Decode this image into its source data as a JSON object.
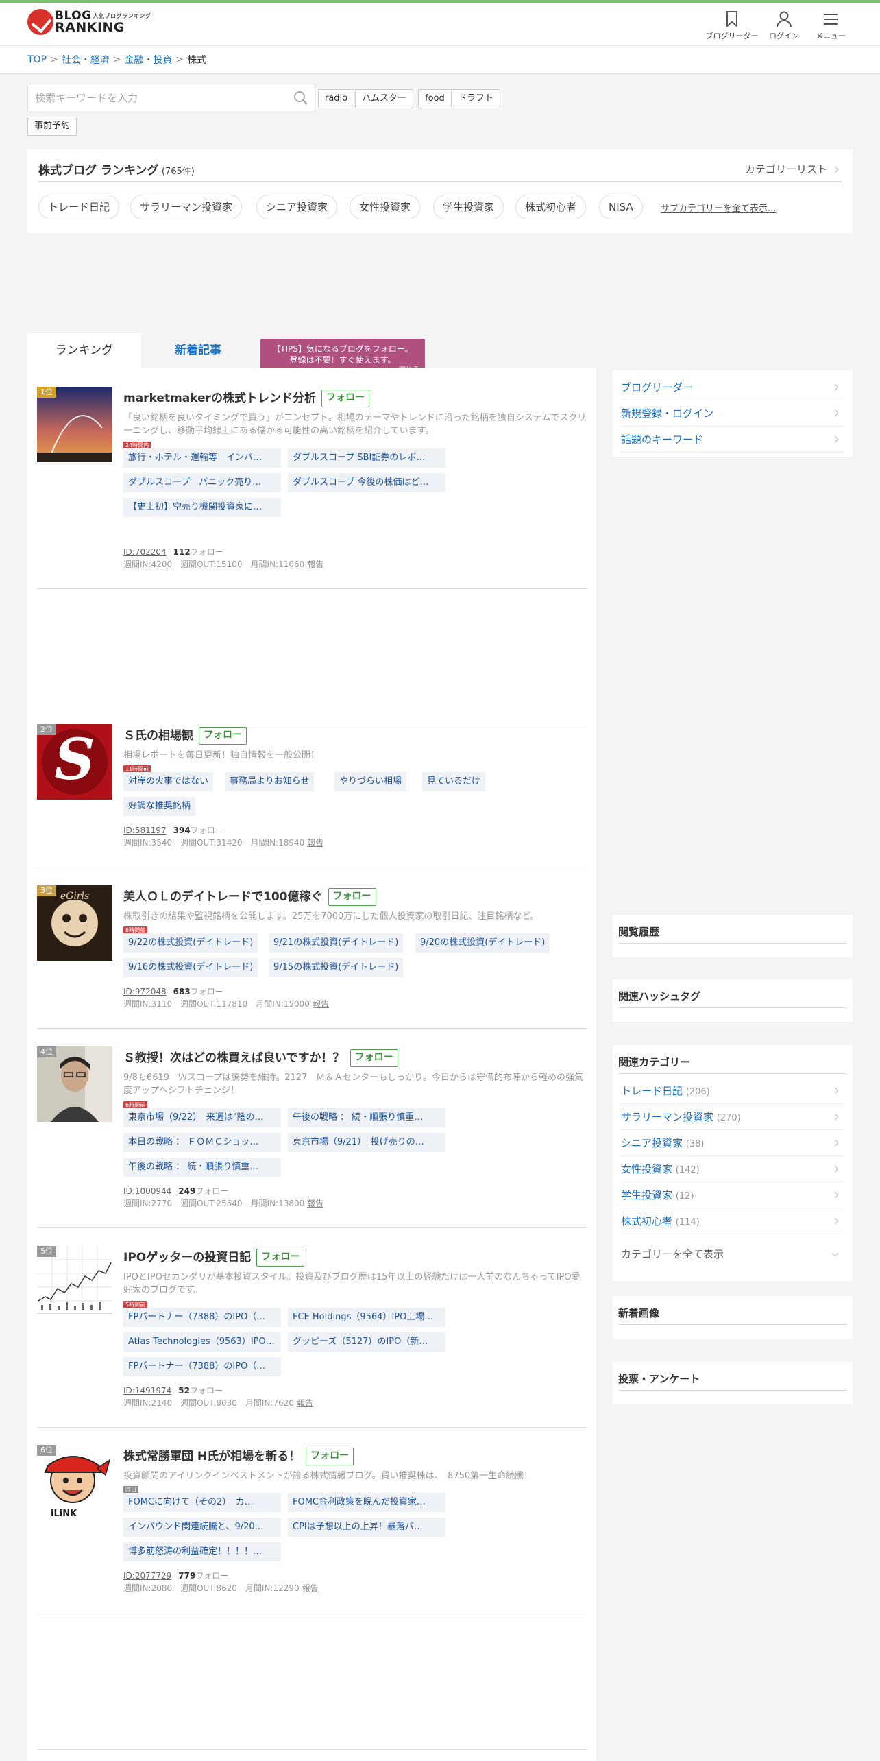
{
  "header": {
    "logo_main": "BLOG",
    "logo_small": "人気ブログランキング",
    "logo_sub": "RANKING",
    "buttons": [
      "ブログリーダー",
      "ログイン",
      "メニュー"
    ]
  },
  "breadcrumb": {
    "items": [
      "TOP",
      "社会・経済",
      "金融・投資"
    ],
    "current": "株式"
  },
  "search": {
    "placeholder": "検索キーワードを入力",
    "tags": [
      "radio",
      "ハムスター",
      "food",
      "ドラフト",
      "事前予約"
    ]
  },
  "category": {
    "title": "株式ブログ ランキング",
    "count": "(765件)",
    "list_link": "カテゴリーリスト",
    "subcategories": [
      "トレード日記",
      "サラリーマン投資家",
      "シニア投資家",
      "女性投資家",
      "学生投資家",
      "株式初心者",
      "NISA"
    ],
    "show_all": "サブカテゴリーを全て表示..."
  },
  "tabs": [
    "ランキング",
    "新着記事"
  ],
  "tips": {
    "line1": "【TIPS】気になるブログをフォロー。",
    "line2": "登録は不要！すぐ使えます。",
    "close": "閉じる"
  },
  "follow_label": "フォロー",
  "follower_suffix": "フォロー",
  "report_label": "報告",
  "entries": [
    {
      "rank": "1位",
      "title": "marketmakerの株式トレンド分析",
      "desc": "「良い銘柄を良いタイミングで買う」がコンセプト。相場のテーマやトレンドに沿った銘柄を独自システムでスクリーニングし、移動平均線上にある儲かる可能性の高い銘柄を紹介しています。",
      "badge": "24時間内",
      "posts": [
        "旅行・ホテル・運輸等　インバ…",
        "ダブルスコープ SBI証券のレポ…",
        "ダブルスコープ　パニック売り…",
        "ダブルスコープ 今後の株価はど…",
        "【史上初】空売り機関投資家に…"
      ],
      "id": "ID:702204",
      "followers": "112",
      "stats": "週間IN:4200　週間OUT:15100　月間IN:11060"
    },
    {
      "rank": "2位",
      "title": "Ｓ氏の相場観",
      "desc": "相場レポートを毎日更新！独自情報を一般公開！",
      "badge": "11時間前",
      "posts": [
        "対岸の火事ではない",
        "事務局よりお知らせ",
        "やりづらい相場",
        "見ているだけ",
        "好調な推奨銘柄"
      ],
      "id": "ID:581197",
      "followers": "394",
      "stats": "週間IN:3540　週間OUT:31420　月間IN:18940"
    },
    {
      "rank": "3位",
      "title": "美人ＯＬのデイトレードで100億稼ぐ",
      "desc": "株取引きの結果や監視銘柄を公開します。25万を7000万にした個人投資家の取引日記、注目銘柄など。",
      "badge": "8時間前",
      "posts": [
        "9/22の株式投資(デイトレード)",
        "9/21の株式投資(デイトレード)",
        "9/20の株式投資(デイトレード)",
        "9/16の株式投資(デイトレード)",
        "9/15の株式投資(デイトレード)"
      ],
      "id": "ID:972048",
      "followers": "683",
      "stats": "週間IN:3110　週間OUT:117810　月間IN:15000"
    },
    {
      "rank": "4位",
      "title": "Ｓ教授！次はどの株買えば良いですか！？",
      "desc": "9/8も6619　Ｗスコープは騰勢を維持。2127　Ｍ＆Ａセンターもしっかり。今日からは守備的布陣から軽めの強気度アップへシフトチェンジ！",
      "badge": "6時間前",
      "posts": [
        "東京市場（9/22）　来週は\"陰の…",
        "午後の戦略 ： 続・順張り慎重…",
        "本日の戦略 ： ＦＯＭＣショッ…",
        "東京市場（9/21）　投げ売りの…",
        "午後の戦略 ： 続・順張り慎重…"
      ],
      "id": "ID:1000944",
      "followers": "249",
      "stats": "週間IN:2770　週間OUT:25640　月間IN:13800"
    },
    {
      "rank": "5位",
      "title": "IPOゲッターの投資日記",
      "desc": "IPOとIPOセカンダリが基本投資スタイル。投資及びブログ歴は15年以上の経験だけは一人前のなんちゃってIPO愛好家のブログです。",
      "badge": "5時間前",
      "posts": [
        "FPパートナー（7388）のIPO（…",
        "FCE Holdings（9564）IPO上場…",
        "Atlas Technologies（9563）IPO…",
        "グッピーズ（5127）のIPO（新…",
        "FPパートナー（7388）のIPO（…"
      ],
      "id": "ID:1491974",
      "followers": "52",
      "stats": "週間IN:2140　週間OUT:8030　月間IN:7620"
    },
    {
      "rank": "6位",
      "title": "株式常勝軍団 H氏が相場を斬る！",
      "desc": "投資顧問のアイリンクインベストメントが誇る株式情報ブログ。買い推奨株は、　8750第一生命続騰！",
      "badge": "昨日",
      "posts": [
        "FOMCに向けて（その2）　カ…",
        "FOMC金利政策を睨んだ投資家…",
        "インバウンド関連続騰と、9/20…",
        "CPIは予想以上の上昇！暴落パ…",
        "博多筋怒涛の利益確定！！！！…"
      ],
      "id": "ID:2077729",
      "followers": "779",
      "stats": "週間IN:2080　週間OUT:8620　月間IN:12290"
    }
  ],
  "sidebar": {
    "links": [
      "ブログリーダー",
      "新規登録・ログイン",
      "話題のキーワード"
    ],
    "history": "閲覧履歴",
    "hashtags": "関連ハッシュタグ",
    "related": "関連カテゴリー",
    "related_items": [
      {
        "name": "トレード日記",
        "count": "(206)"
      },
      {
        "name": "サラリーマン投資家",
        "count": "(270)"
      },
      {
        "name": "シニア投資家",
        "count": "(38)"
      },
      {
        "name": "女性投資家",
        "count": "(142)"
      },
      {
        "name": "学生投資家",
        "count": "(12)"
      },
      {
        "name": "株式初心者",
        "count": "(114)"
      }
    ],
    "show_all_categories": "カテゴリーを全て表示",
    "new_images": "新着画像",
    "votes": "投票・アンケート"
  },
  "colors": {
    "accent": "#1a6fc4",
    "follow_green": "#4ca54c",
    "tips_bg": "#b0507f",
    "header_line": "#77c26a"
  }
}
